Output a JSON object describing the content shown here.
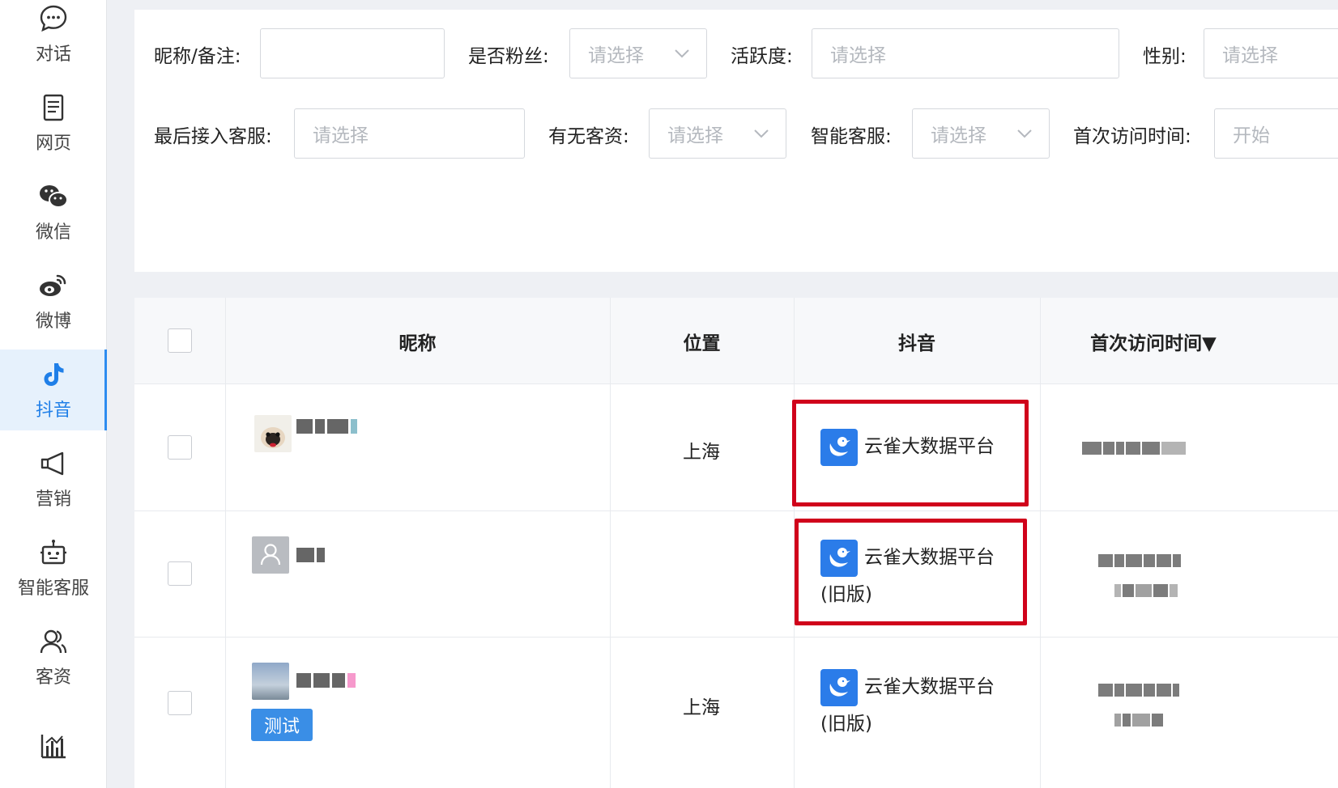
{
  "sidebar": {
    "items": [
      {
        "label": "对话",
        "icon": "chat-icon"
      },
      {
        "label": "网页",
        "icon": "webpage-icon"
      },
      {
        "label": "微信",
        "icon": "wechat-icon"
      },
      {
        "label": "微博",
        "icon": "weibo-icon"
      },
      {
        "label": "抖音",
        "icon": "douyin-icon",
        "active": true
      },
      {
        "label": "营销",
        "icon": "megaphone-icon"
      },
      {
        "label": "智能客服",
        "icon": "robot-icon"
      },
      {
        "label": "客资",
        "icon": "customers-icon"
      }
    ],
    "active_color": "#1f7fe8"
  },
  "filters": {
    "nickname_label": "昵称/备注:",
    "nickname_value": "",
    "is_fan_label": "是否粉丝:",
    "is_fan_placeholder": "请选择",
    "activity_label": "活跃度:",
    "activity_placeholder": "请选择",
    "gender_label": "性别:",
    "gender_placeholder": "请选择",
    "last_agent_label": "最后接入客服:",
    "last_agent_placeholder": "请选择",
    "has_lead_label": "有无客资:",
    "has_lead_placeholder": "请选择",
    "smart_service_label": "智能客服:",
    "smart_service_placeholder": "请选择",
    "first_visit_label": "首次访问时间:",
    "first_visit_placeholder": "开始"
  },
  "table": {
    "headers": {
      "nickname": "昵称",
      "location": "位置",
      "douyin": "抖音",
      "first_visit": "首次访问时间▼"
    },
    "rows": [
      {
        "location": "上海",
        "platform": "云雀大数据平台",
        "platform_suffix": "",
        "tag": ""
      },
      {
        "location": "",
        "platform": "云雀大数据平台",
        "platform_suffix": "(旧版)",
        "tag": ""
      },
      {
        "location": "上海",
        "platform": "云雀大数据平台",
        "platform_suffix": "(旧版)",
        "tag": "测试"
      }
    ]
  },
  "colors": {
    "accent": "#2b7ce9",
    "highlight": "#d0021b",
    "tag_bg": "#3a8ee6"
  }
}
